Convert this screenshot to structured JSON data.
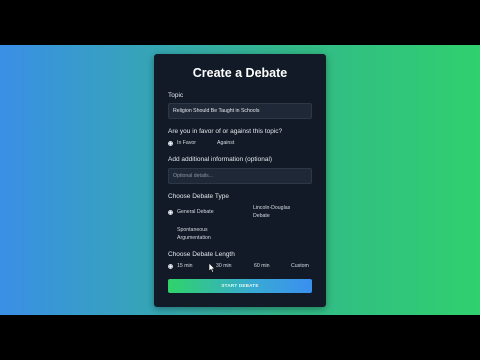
{
  "form": {
    "title": "Create a Debate",
    "topic_label": "Topic",
    "topic_value": "Religion Should Be Taught in Schools",
    "stance_label": "Are you in favor of or against this topic?",
    "stance_options": [
      "In Favor",
      "Against"
    ],
    "stance_selected": "In Favor",
    "info_label": "Add additional information (optional)",
    "info_placeholder": "Optional details...",
    "type_label": "Choose Debate Type",
    "type_options": [
      "General Debate",
      "Lincoln-Douglas Debate",
      "Spontaneous Argumentation"
    ],
    "type_selected": "General Debate",
    "length_label": "Choose Debate Length",
    "length_options": [
      "15 min",
      "30 min",
      "60 min",
      "Custom"
    ],
    "length_selected": "15 min",
    "submit_label": "START DEBATE"
  },
  "colors": {
    "card_bg": "#111a26",
    "input_bg": "#1e2836",
    "accent_start": "#2fd36a",
    "accent_end": "#3a8ff0"
  }
}
